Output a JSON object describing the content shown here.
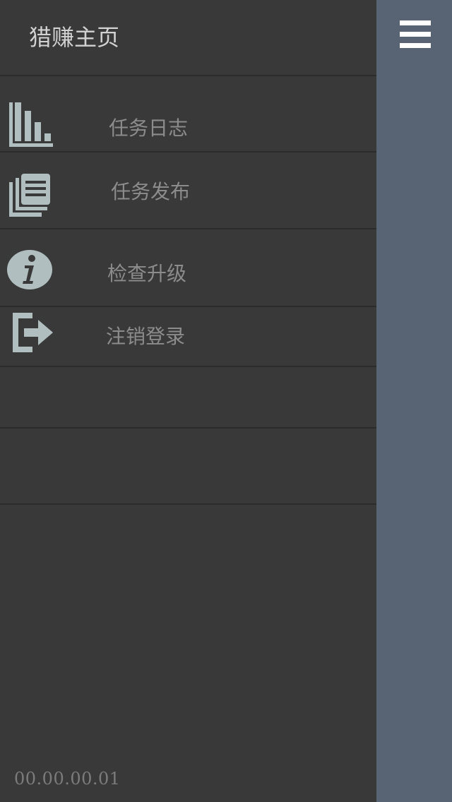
{
  "header": {
    "title": "猎赚主页",
    "menu_icon": "hamburger-menu-icon"
  },
  "menu": {
    "items": [
      {
        "label": "任务日志",
        "icon": "bar-chart-icon"
      },
      {
        "label": "任务发布",
        "icon": "documents-icon"
      },
      {
        "label": "检查升级",
        "icon": "info-icon"
      },
      {
        "label": "注销登录",
        "icon": "logout-icon"
      }
    ]
  },
  "footer": {
    "version": "00.00.00.01"
  },
  "colors": {
    "drawer_bg": "#393939",
    "panel_bg": "#586374",
    "icon": "#b0bec0",
    "label": "#8c8c8c"
  }
}
